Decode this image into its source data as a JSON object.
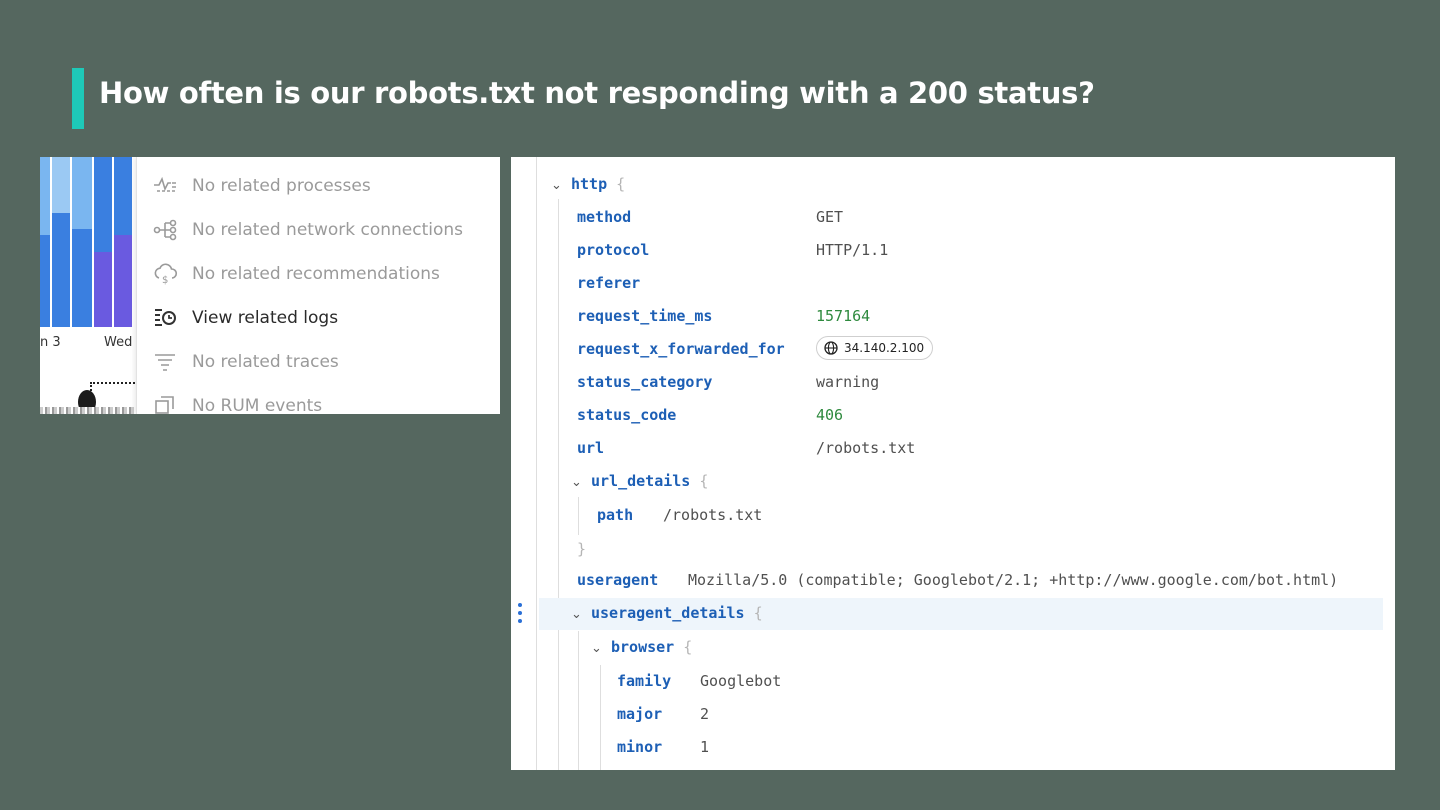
{
  "slide": {
    "title": "How often is our robots.txt not responding with a 200 status?",
    "accent_color": "#1ec9b8",
    "background_color": "#55675f"
  },
  "left_panel": {
    "chart_labels": [
      "n 3",
      "Wed"
    ],
    "menu": [
      {
        "label": "No related processes",
        "icon": "processes-icon",
        "active": false
      },
      {
        "label": "No related network connections",
        "icon": "network-icon",
        "active": false
      },
      {
        "label": "No related recommendations",
        "icon": "recommendations-icon",
        "active": false
      },
      {
        "label": "View related logs",
        "icon": "logs-icon",
        "active": true
      },
      {
        "label": "No related traces",
        "icon": "traces-icon",
        "active": false
      },
      {
        "label": "No RUM events",
        "icon": "rum-icon",
        "active": false
      }
    ]
  },
  "json_view": {
    "http": {
      "key": "http",
      "brace": "{",
      "fields": [
        {
          "key": "method",
          "value": "GET"
        },
        {
          "key": "protocol",
          "value": "HTTP/1.1"
        },
        {
          "key": "referer",
          "value": ""
        },
        {
          "key": "request_time_ms",
          "value": "157164"
        },
        {
          "key": "request_x_forwarded_for",
          "value": "34.140.2.100"
        },
        {
          "key": "status_category",
          "value": "warning"
        },
        {
          "key": "status_code",
          "value": "406"
        },
        {
          "key": "url",
          "value": "/robots.txt"
        }
      ],
      "url_details": {
        "key": "url_details",
        "brace": "{",
        "path_key": "path",
        "path_value": "/robots.txt",
        "close": "}"
      },
      "useragent": {
        "key": "useragent",
        "value": "Mozilla/5.0 (compatible; Googlebot/2.1; +http://www.google.com/bot.html)"
      },
      "useragent_details": {
        "key": "useragent_details",
        "brace": "{",
        "browser": {
          "key": "browser",
          "brace": "{",
          "family_key": "family",
          "family_value": "Googlebot",
          "major_key": "major",
          "major_value": "2",
          "minor_key": "minor",
          "minor_value": "1"
        }
      }
    }
  }
}
